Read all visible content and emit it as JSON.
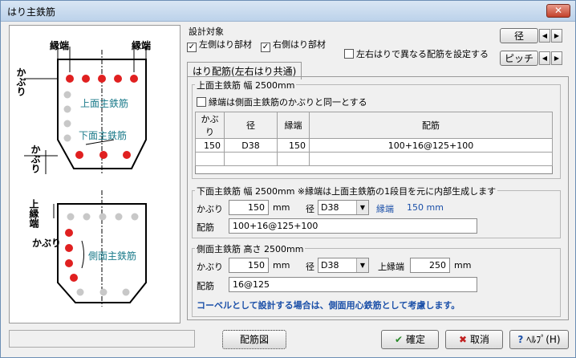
{
  "window": {
    "title": "はり主鉄筋",
    "close_label": "✕"
  },
  "diagram": {
    "edge_label_left": "縁端",
    "edge_label_right": "縁端",
    "cover_top": "かぶり",
    "top_bars": "上面主鉄筋",
    "bottom_bars": "下面主鉄筋",
    "cover_bottom": "かぶり",
    "upper_edge": "上縁端",
    "cover_side": "かぶり",
    "side_bars": "側面主鉄筋"
  },
  "design_target": {
    "label": "設計対象",
    "left_member": "左側はり部材",
    "right_member": "右側はり部材",
    "left_checked": true,
    "right_checked": true
  },
  "diff_check": "左右はりで異なる配筋を設定する",
  "nav": {
    "diameter": "径",
    "pitch": "ピッチ"
  },
  "tab": {
    "label": "はり配筋(左右はり共通)"
  },
  "top_group": {
    "title": "上面主鉄筋  幅  2500mm",
    "same_cover_check": "縁端は側面主鉄筋のかぶりと同一とする",
    "columns": [
      "かぶり",
      "径",
      "縁端",
      "配筋"
    ],
    "rows": [
      [
        "150",
        "D38",
        "150",
        "100+16@125+100"
      ]
    ]
  },
  "bottom_group": {
    "title": "下面主鉄筋  幅  2500mm ※縁端は上面主鉄筋の1段目を元に内部生成します",
    "cover_label": "かぶり",
    "cover_value": "150",
    "unit": "mm",
    "dia_label": "径",
    "dia_value": "D38",
    "edge_label": "縁端",
    "edge_value": "150 mm",
    "arr_label": "配筋",
    "arr_value": "100+16@125+100"
  },
  "side_group": {
    "title": "側面主鉄筋  高さ  2500mm",
    "cover_label": "かぶり",
    "cover_value": "150",
    "unit": "mm",
    "dia_label": "径",
    "dia_value": "D38",
    "edge_label": "上縁端",
    "edge_value": "250",
    "edge_unit": "mm",
    "arr_label": "配筋",
    "arr_value": "16@125",
    "note": "コーベルとして設計する場合は、側面用心鉄筋として考慮します。"
  },
  "footer": {
    "draw_button": "配筋図",
    "ok_button": "確定",
    "cancel_button": "取消",
    "help_button": "ﾍﾙﾌﾟ(H)"
  },
  "colors": {
    "bar_red": "#e02020",
    "bar_gray": "#c8c8c8",
    "label_blue": "#1a7a8a"
  }
}
